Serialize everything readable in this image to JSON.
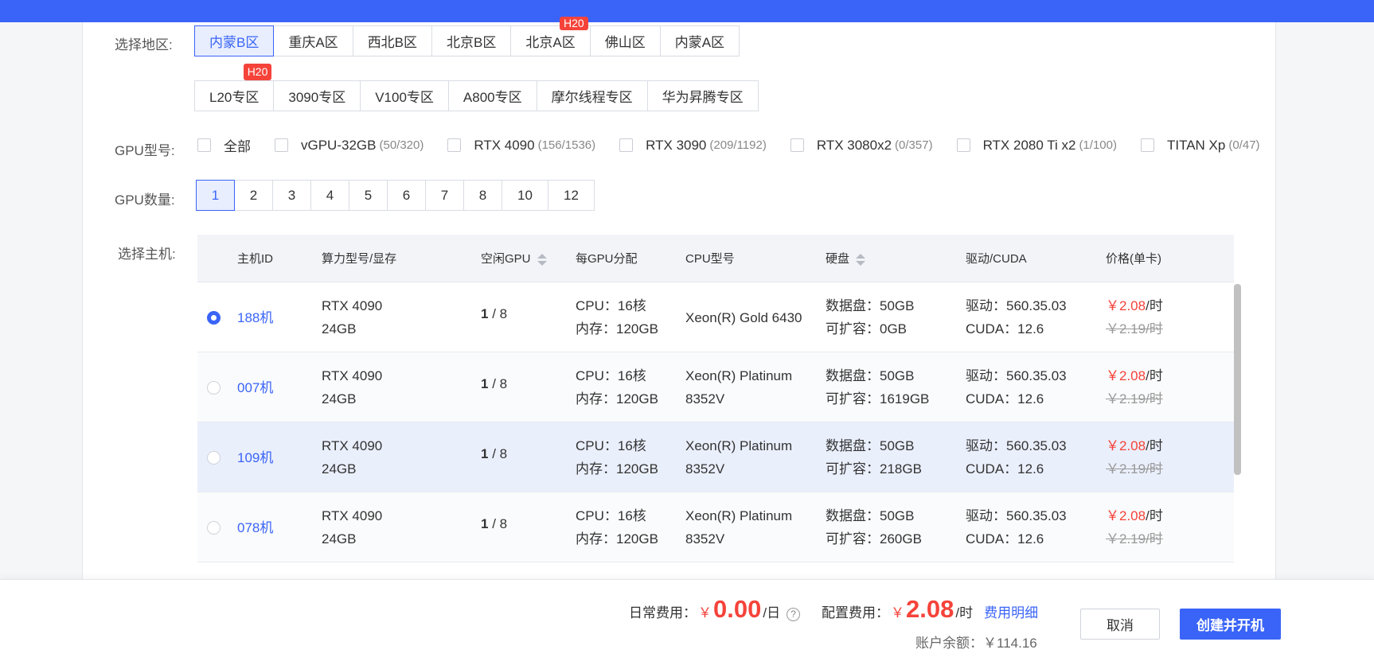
{
  "region": {
    "label": "选择地区:",
    "row1": [
      {
        "label": "内蒙B区",
        "active": true
      },
      {
        "label": "重庆A区"
      },
      {
        "label": "西北B区"
      },
      {
        "label": "北京B区"
      },
      {
        "label": "北京A区",
        "tag": "H20"
      },
      {
        "label": "佛山区"
      },
      {
        "label": "内蒙A区"
      }
    ],
    "row2": [
      {
        "label": "L20专区",
        "tag": "H20"
      },
      {
        "label": "3090专区"
      },
      {
        "label": "V100专区"
      },
      {
        "label": "A800专区"
      },
      {
        "label": "摩尔线程专区"
      },
      {
        "label": "华为昇腾专区"
      }
    ]
  },
  "gpu_model": {
    "label": "GPU型号:",
    "options": [
      {
        "name": "全部",
        "count": ""
      },
      {
        "name": "vGPU-32GB",
        "count": "(50/320)"
      },
      {
        "name": "RTX 4090",
        "count": "(156/1536)"
      },
      {
        "name": "RTX 3090",
        "count": "(209/1192)"
      },
      {
        "name": "RTX 3080x2",
        "count": "(0/357)"
      },
      {
        "name": "RTX 2080 Ti x2",
        "count": "(1/100)"
      },
      {
        "name": "TITAN Xp",
        "count": "(0/47)"
      }
    ]
  },
  "gpu_count": {
    "label": "GPU数量:",
    "options": [
      "1",
      "2",
      "3",
      "4",
      "5",
      "6",
      "7",
      "8",
      "10",
      "12"
    ],
    "selected": "1"
  },
  "host": {
    "label": "选择主机:",
    "headers": {
      "id": "主机ID",
      "model": "算力型号/显存",
      "free": "空闲GPU",
      "per_gpu": "每GPU分配",
      "cpu": "CPU型号",
      "disk": "硬盘",
      "driver": "驱动/CUDA",
      "price": "价格(单卡)"
    },
    "rows": [
      {
        "id": "188机",
        "model": "RTX 4090",
        "mem": "24GB",
        "free": "1",
        "total": " / 8",
        "cpu_alloc": "CPU：16核",
        "ram": "内存：120GB",
        "cpu1": "Xeon(R) Gold 6430",
        "cpu2": "",
        "disk": "数据盘：50GB",
        "ext": "可扩容：0GB",
        "driver": "驱动：560.35.03",
        "cuda": "CUDA：12.6",
        "price": "￥2.08",
        "unit": "/时",
        "orig": "￥2.19/时",
        "selected": true
      },
      {
        "id": "007机",
        "model": "RTX 4090",
        "mem": "24GB",
        "free": "1",
        "total": " / 8",
        "cpu_alloc": "CPU：16核",
        "ram": "内存：120GB",
        "cpu1": "Xeon(R) Platinum",
        "cpu2": "8352V",
        "disk": "数据盘：50GB",
        "ext": "可扩容：1619GB",
        "driver": "驱动：560.35.03",
        "cuda": "CUDA：12.6",
        "price": "￥2.08",
        "unit": "/时",
        "orig": "￥2.19/时"
      },
      {
        "id": "109机",
        "model": "RTX 4090",
        "mem": "24GB",
        "free": "1",
        "total": " / 8",
        "cpu_alloc": "CPU：16核",
        "ram": "内存：120GB",
        "cpu1": "Xeon(R) Platinum",
        "cpu2": "8352V",
        "disk": "数据盘：50GB",
        "ext": "可扩容：218GB",
        "driver": "驱动：560.35.03",
        "cuda": "CUDA：12.6",
        "price": "￥2.08",
        "unit": "/时",
        "orig": "￥2.19/时"
      },
      {
        "id": "078机",
        "model": "RTX 4090",
        "mem": "24GB",
        "free": "1",
        "total": " / 8",
        "cpu_alloc": "CPU：16核",
        "ram": "内存：120GB",
        "cpu1": "Xeon(R) Platinum",
        "cpu2": "8352V",
        "disk": "数据盘：50GB",
        "ext": "可扩容：260GB",
        "driver": "驱动：560.35.03",
        "cuda": "CUDA：12.6",
        "price": "￥2.08",
        "unit": "/时",
        "orig": "￥2.19/时"
      }
    ]
  },
  "footer": {
    "daily_label": "日常费用：",
    "daily_cur": "￥",
    "daily_value": "0.00",
    "daily_unit": "/日",
    "help_icon": "?",
    "config_label": "配置费用：",
    "config_cur": "￥",
    "config_value": "2.08",
    "config_unit": "/时",
    "detail_link": "费用明细",
    "balance": "账户余额：￥114.16",
    "cancel": "取消",
    "create": "创建并开机"
  },
  "colors": {
    "accent": "#3a64f7",
    "price": "#f5433a"
  }
}
